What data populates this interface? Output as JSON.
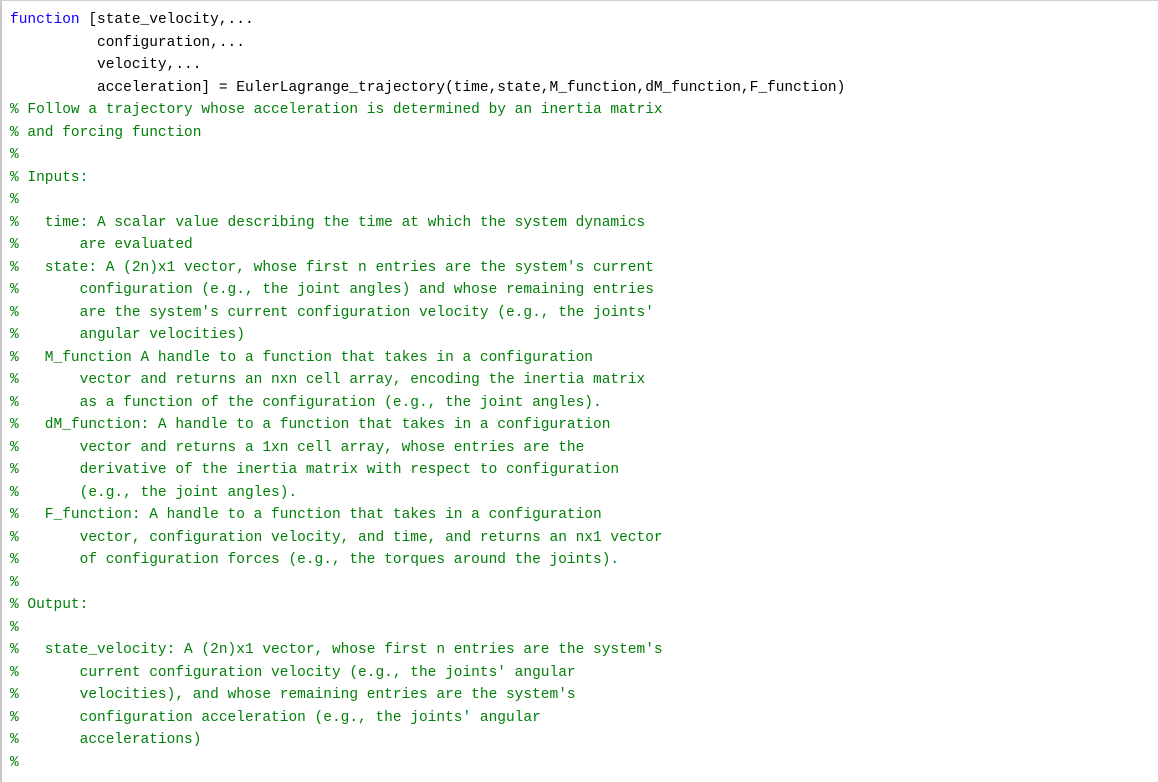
{
  "editor": {
    "lines": [
      [
        {
          "cls": "tok-keyword",
          "text": "function"
        },
        {
          "cls": "tok-text",
          "text": " [state_velocity,..."
        }
      ],
      [
        {
          "cls": "tok-text",
          "text": "          configuration,..."
        }
      ],
      [
        {
          "cls": "tok-text",
          "text": "          velocity,..."
        }
      ],
      [
        {
          "cls": "tok-text",
          "text": "          acceleration] = EulerLagrange_trajectory(time,state,M_function,dM_function,F_function)"
        }
      ],
      [
        {
          "cls": "tok-comment",
          "text": "% Follow a trajectory whose acceleration is determined by an inertia matrix"
        }
      ],
      [
        {
          "cls": "tok-comment",
          "text": "% and forcing function"
        }
      ],
      [
        {
          "cls": "tok-comment",
          "text": "%"
        }
      ],
      [
        {
          "cls": "tok-comment",
          "text": "% Inputs:"
        }
      ],
      [
        {
          "cls": "tok-comment",
          "text": "%"
        }
      ],
      [
        {
          "cls": "tok-comment",
          "text": "%   time: A scalar value describing the time at which the system dynamics"
        }
      ],
      [
        {
          "cls": "tok-comment",
          "text": "%       are evaluated"
        }
      ],
      [
        {
          "cls": "tok-comment",
          "text": "%   state: A (2n)x1 vector, whose first n entries are the system's current"
        }
      ],
      [
        {
          "cls": "tok-comment",
          "text": "%       configuration (e.g., the joint angles) and whose remaining entries"
        }
      ],
      [
        {
          "cls": "tok-comment",
          "text": "%       are the system's current configuration velocity (e.g., the joints'"
        }
      ],
      [
        {
          "cls": "tok-comment",
          "text": "%       angular velocities)"
        }
      ],
      [
        {
          "cls": "tok-comment",
          "text": "%   M_function A handle to a function that takes in a configuration"
        }
      ],
      [
        {
          "cls": "tok-comment",
          "text": "%       vector and returns an nxn cell array, encoding the inertia matrix"
        }
      ],
      [
        {
          "cls": "tok-comment",
          "text": "%       as a function of the configuration (e.g., the joint angles)."
        }
      ],
      [
        {
          "cls": "tok-comment",
          "text": "%   dM_function: A handle to a function that takes in a configuration"
        }
      ],
      [
        {
          "cls": "tok-comment",
          "text": "%       vector and returns a 1xn cell array, whose entries are the"
        }
      ],
      [
        {
          "cls": "tok-comment",
          "text": "%       derivative of the inertia matrix with respect to configuration"
        }
      ],
      [
        {
          "cls": "tok-comment",
          "text": "%       (e.g., the joint angles)."
        }
      ],
      [
        {
          "cls": "tok-comment",
          "text": "%   F_function: A handle to a function that takes in a configuration"
        }
      ],
      [
        {
          "cls": "tok-comment",
          "text": "%       vector, configuration velocity, and time, and returns an nx1 vector"
        }
      ],
      [
        {
          "cls": "tok-comment",
          "text": "%       of configuration forces (e.g., the torques around the joints)."
        }
      ],
      [
        {
          "cls": "tok-comment",
          "text": "%"
        }
      ],
      [
        {
          "cls": "tok-comment",
          "text": "% Output:"
        }
      ],
      [
        {
          "cls": "tok-comment",
          "text": "%"
        }
      ],
      [
        {
          "cls": "tok-comment",
          "text": "%   state_velocity: A (2n)x1 vector, whose first n entries are the system's"
        }
      ],
      [
        {
          "cls": "tok-comment",
          "text": "%       current configuration velocity (e.g., the joints' angular"
        }
      ],
      [
        {
          "cls": "tok-comment",
          "text": "%       velocities), and whose remaining entries are the system's"
        }
      ],
      [
        {
          "cls": "tok-comment",
          "text": "%       configuration acceleration (e.g., the joints' angular"
        }
      ],
      [
        {
          "cls": "tok-comment",
          "text": "%       accelerations)"
        }
      ],
      [
        {
          "cls": "tok-comment",
          "text": "%"
        }
      ]
    ]
  }
}
